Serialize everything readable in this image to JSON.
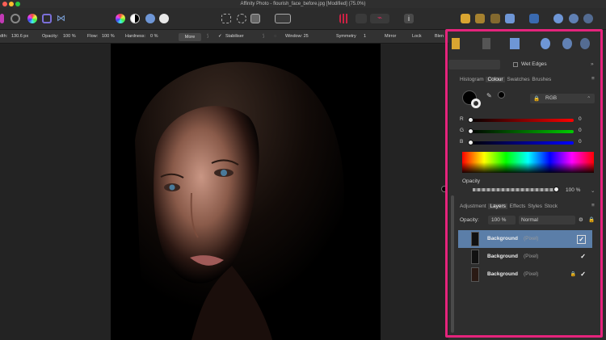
{
  "window": {
    "title": "Affinity Photo - flourish_face_before.jpg [Modified] (75.0%)"
  },
  "context_toolbar": {
    "width_label": "dth:",
    "width_value": "130.6 px",
    "opacity_label": "Opacity:",
    "opacity_value": "100 %",
    "flow_label": "Flow:",
    "flow_value": "100 %",
    "hardness_label": "Hardness:",
    "hardness_value": "0 %",
    "more_label": "More",
    "stabiliser_label": "Stabiliser",
    "window_label": "Window: 25",
    "symmetry_label": "Symmetry",
    "symmetry_value": "1",
    "mirror_label": "Mirror",
    "lock_label": "Lock",
    "blend_label": "Blen"
  },
  "panel": {
    "wet_edges_label": "Wet Edges",
    "tabs_top": [
      "Histogram",
      "Colour",
      "Swatches",
      "Brushes"
    ],
    "active_top_tab": "Colour",
    "colour_model": "RGB",
    "channels": [
      {
        "name": "R",
        "value": "0"
      },
      {
        "name": "G",
        "value": "0"
      },
      {
        "name": "B",
        "value": "0"
      }
    ],
    "opacity_label": "Opacity",
    "opacity_value": "100 %",
    "tabs_bottom": [
      "Adjustment",
      "Layers",
      "Effects",
      "Styles",
      "Stock"
    ],
    "active_bottom_tab": "Layers",
    "layers_opacity_label": "Opacity:",
    "layers_opacity_value": "100 %",
    "blend_mode": "Normal",
    "layers": [
      {
        "name": "Background",
        "kind": "(Pixel)",
        "selected": true,
        "visible": true,
        "locked": false
      },
      {
        "name": "Background",
        "kind": "(Pixel)",
        "selected": false,
        "visible": true,
        "locked": false
      },
      {
        "name": "Background",
        "kind": "(Pixel)",
        "selected": false,
        "visible": true,
        "locked": true
      }
    ]
  },
  "colors": {
    "highlight": "#e5247c",
    "selected_layer": "#5b7ea8",
    "panel": "#2e2e2e"
  }
}
